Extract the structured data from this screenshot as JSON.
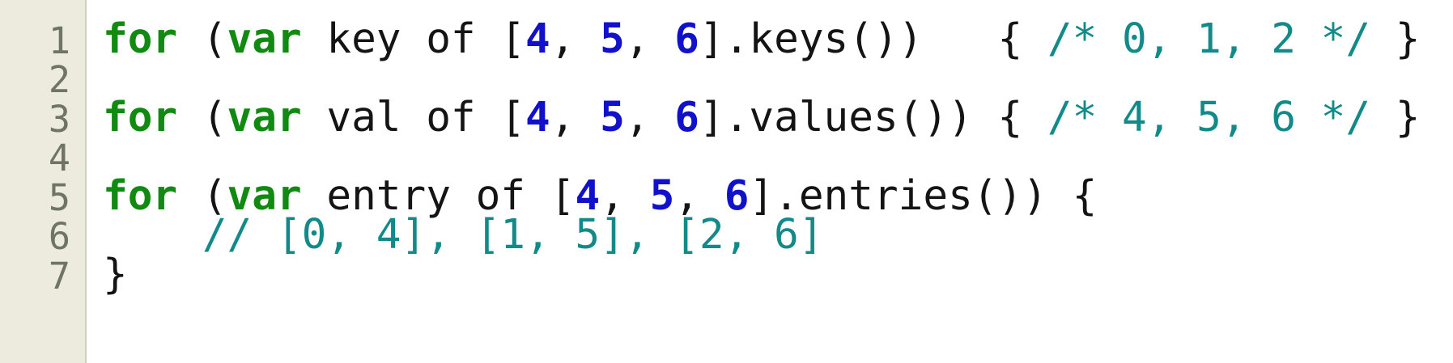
{
  "line_numbers": [
    "1",
    "2",
    "3",
    "4",
    "5",
    "6",
    "7"
  ],
  "colors": {
    "gutter_bg": "#ecebdd",
    "keyword": "#118a11",
    "number": "#1111cc",
    "comment": "#138a8a",
    "text": "#141414",
    "line_number": "#6f7562"
  },
  "lines": {
    "l1": {
      "kw_for": "for",
      "open": " (",
      "kw_var": "var",
      "mid": " key of [",
      "n1": "4",
      "sep1": ", ",
      "n2": "5",
      "sep2": ", ",
      "n3": "6",
      "rest": "].keys())   { ",
      "comment": "/* 0, 1, 2 */",
      "close": " }"
    },
    "l3": {
      "kw_for": "for",
      "open": " (",
      "kw_var": "var",
      "mid": " val of [",
      "n1": "4",
      "sep1": ", ",
      "n2": "5",
      "sep2": ", ",
      "n3": "6",
      "rest": "].values()) { ",
      "comment": "/* 4, 5, 6 */",
      "close": " }"
    },
    "l5": {
      "kw_for": "for",
      "open": " (",
      "kw_var": "var",
      "mid": " entry of [",
      "n1": "4",
      "sep1": ", ",
      "n2": "5",
      "sep2": ", ",
      "n3": "6",
      "rest": "].entries()) {"
    },
    "l6": {
      "indent": "    ",
      "comment": "// [0, 4], [1, 5], [2, 6]"
    },
    "l7": {
      "text": "}"
    }
  }
}
